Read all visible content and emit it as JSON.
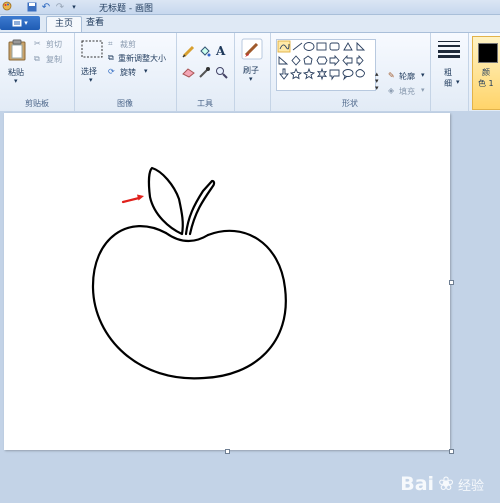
{
  "window": {
    "title": "无标题 - 画图"
  },
  "tabs": [
    {
      "label": "主页",
      "active": true
    },
    {
      "label": "查看",
      "active": false
    }
  ],
  "ribbon": {
    "clipboard": {
      "group_label": "剪贴板",
      "paste": "粘贴",
      "cut": "剪切",
      "copy": "复制"
    },
    "image": {
      "group_label": "图像",
      "select": "选择",
      "crop": "裁剪",
      "resize": "重新调整大小",
      "rotate": "旋转"
    },
    "tools": {
      "group_label": "工具"
    },
    "brushes": {
      "label": "刷子"
    },
    "shapes": {
      "group_label": "形状",
      "outline": "轮廓",
      "fill": "填充"
    },
    "size": {
      "label_line1": "粗",
      "label_line2": "细"
    },
    "color": {
      "label_line1": "颜",
      "label_line2": "色 1",
      "value": "#000000"
    }
  },
  "watermark": {
    "text": "Bai",
    "suffix": "经验"
  },
  "colors": {
    "accent": "#1f5cb4",
    "arrow": "#e0201b",
    "canvas": "#ffffff",
    "workspace": "#c3d3e7"
  }
}
